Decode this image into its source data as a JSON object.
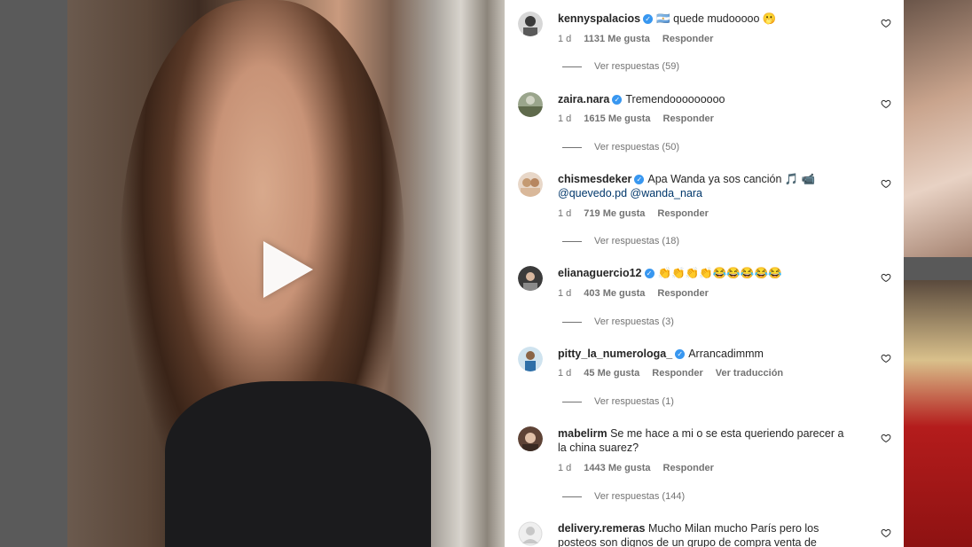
{
  "comments": [
    {
      "username": "kennyspalacios",
      "verified": true,
      "text": "🇦🇷 quede mudooooo 🫢",
      "age": "1 d",
      "likes": "1131 Me gusta",
      "reply": "Responder",
      "translate": "",
      "replies": "Ver respuestas (59)"
    },
    {
      "username": "zaira.nara",
      "verified": true,
      "text": "Tremendooooooooo",
      "age": "1 d",
      "likes": "1615 Me gusta",
      "reply": "Responder",
      "translate": "",
      "replies": "Ver respuestas (50)"
    },
    {
      "username": "chismesdeker",
      "verified": true,
      "text": "Apa Wanda ya sos canción 🎵 📹",
      "mention_1": "@quevedo.pd",
      "mention_2": "@wanda_nara",
      "age": "1 d",
      "likes": "719 Me gusta",
      "reply": "Responder",
      "translate": "",
      "replies": "Ver respuestas (18)"
    },
    {
      "username": "elianaguercio12",
      "verified": true,
      "text": "👏👏👏👏😂😂😂😂😂",
      "age": "1 d",
      "likes": "403 Me gusta",
      "reply": "Responder",
      "translate": "",
      "replies": "Ver respuestas (3)"
    },
    {
      "username": "pitty_la_numerologa_",
      "verified": true,
      "text": "Arrancadimmm",
      "age": "1 d",
      "likes": "45 Me gusta",
      "reply": "Responder",
      "translate": "Ver traducción",
      "replies": "Ver respuestas (1)"
    },
    {
      "username": "mabelirm",
      "verified": false,
      "text": "Se me hace a mi o se esta queriendo parecer a la china suarez?",
      "age": "1 d",
      "likes": "1443 Me gusta",
      "reply": "Responder",
      "translate": "",
      "replies": "Ver respuestas (144)"
    },
    {
      "username": "delivery.remeras",
      "verified": false,
      "text": "Mucho Milan mucho París pero los posteos son dignos de un grupo de compra venta de Zárate",
      "age": "",
      "likes": "",
      "reply": "",
      "translate": "",
      "replies": ""
    }
  ],
  "icons": {
    "heart": "heart-outline-icon",
    "play": "play-icon",
    "verified": "verified-badge-icon"
  },
  "colors": {
    "verified": "#3897f0",
    "text": "#262626",
    "meta": "#737373",
    "mention": "#00376b"
  }
}
